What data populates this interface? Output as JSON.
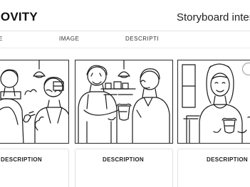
{
  "header": {
    "brand": "IOVITY",
    "page_title": "Storyboard inter"
  },
  "columns": {
    "c0": "E",
    "c1": "IMAGE",
    "c2": "DESCRIPTI"
  },
  "frames": [
    {
      "description_label": "DESCRIPTION",
      "scene": "two-people-talking-in-kitchen"
    },
    {
      "description_label": "DESCRIPTION",
      "scene": "barista-handing-coffee"
    },
    {
      "description_label": "DESCRIPTION",
      "scene": "woman-holding-cup-at-cafe"
    }
  ],
  "icons": {
    "add": "circle-button-icon"
  }
}
